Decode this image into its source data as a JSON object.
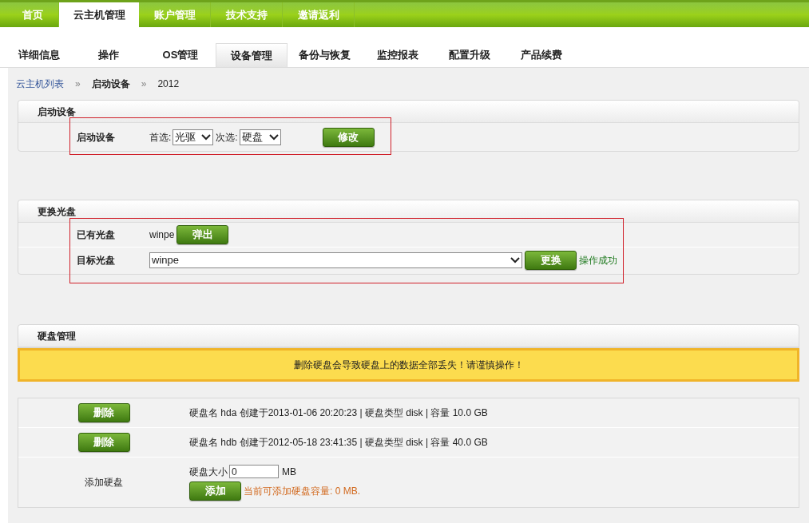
{
  "main_nav": [
    {
      "label": "首页",
      "selected": false
    },
    {
      "label": "云主机管理",
      "selected": true
    },
    {
      "label": "账户管理",
      "selected": false
    },
    {
      "label": "技术支持",
      "selected": false
    },
    {
      "label": "邀请返利",
      "selected": false
    }
  ],
  "sub_tabs": [
    {
      "label": "详细信息",
      "selected": false
    },
    {
      "label": "操作",
      "selected": false
    },
    {
      "label": "OS管理",
      "selected": false
    },
    {
      "label": "设备管理",
      "selected": true
    },
    {
      "label": "备份与恢复",
      "selected": false
    },
    {
      "label": "监控报表",
      "selected": false
    },
    {
      "label": "配置升级",
      "selected": false
    },
    {
      "label": "产品续费",
      "selected": false
    }
  ],
  "breadcrumb": {
    "link": "云主机列表",
    "separator": "»",
    "current": "启动设备",
    "separator_2": "»",
    "item": "2012"
  },
  "boot_device": {
    "title": "启动设备",
    "label": "启动设备",
    "first_label": "首选:",
    "first_value": "光驱",
    "second_label": "次选:",
    "second_value": "硬盘",
    "button": "修改"
  },
  "change_disc": {
    "title": "更换光盘",
    "current_label": "已有光盘",
    "current_value": "winpe",
    "eject_button": "弹出",
    "target_label": "目标光盘",
    "target_value": "winpe",
    "change_button": "更换",
    "status": "操作成功"
  },
  "disk_management": {
    "title": "硬盘管理",
    "warning": "删除硬盘会导致硬盘上的数据全部丢失！请谨慎操作！",
    "disks": [
      {
        "button": "删除",
        "info": "硬盘名 hda 创建于2013-01-06 20:20:23 | 硬盘类型 disk | 容量 10.0 GB"
      },
      {
        "button": "删除",
        "info": "硬盘名 hdb 创建于2012-05-18 23:41:35 | 硬盘类型 disk | 容量 40.0 GB"
      }
    ],
    "add": {
      "label": "添加硬盘",
      "size_label": "硬盘大小",
      "size_value": "0",
      "unit": "MB",
      "button": "添加",
      "capacity_note": "当前可添加硬盘容量: 0 MB."
    }
  }
}
